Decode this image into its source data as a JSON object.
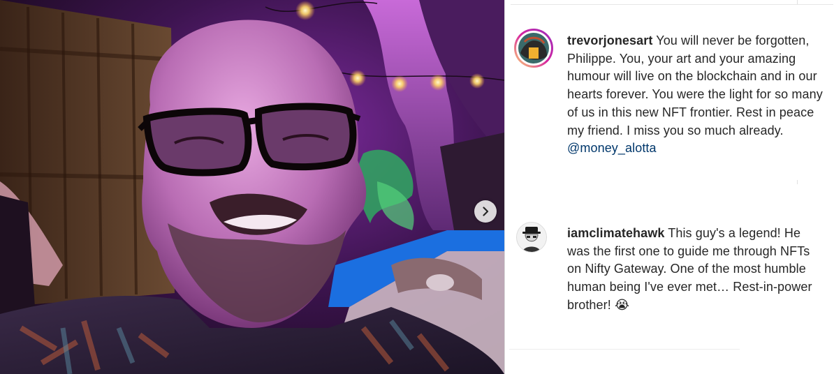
{
  "post": {
    "photo_alt": "Selfie of a smiling bald man with glasses under purple lights",
    "next_button_label": "Next"
  },
  "comments": [
    {
      "username": "trevorjonesart",
      "text": "You will never be forgotten, Philippe. You, your art and your amazing humour will live on the blockchain and in our hearts forever. You were the light for so many of us in this new NFT frontier. Rest in peace my friend. I miss you so much already.",
      "mention": "@money_alotta"
    },
    {
      "username": "iamclimatehawk",
      "text": "This guy's a legend! He was the first one to guide me through NFTs on Nifty Gateway. One of the most humble human being I've ever met… Rest-in-power brother!",
      "emoji": "😭"
    }
  ],
  "colors": {
    "text": "#262626",
    "mention": "#00376b",
    "divider": "#dbdbdb",
    "story_ring": "#d6249f"
  },
  "icons": {
    "next": "chevron-right-icon",
    "avatar1": "avatar-icon",
    "avatar2": "avatar-icon"
  }
}
